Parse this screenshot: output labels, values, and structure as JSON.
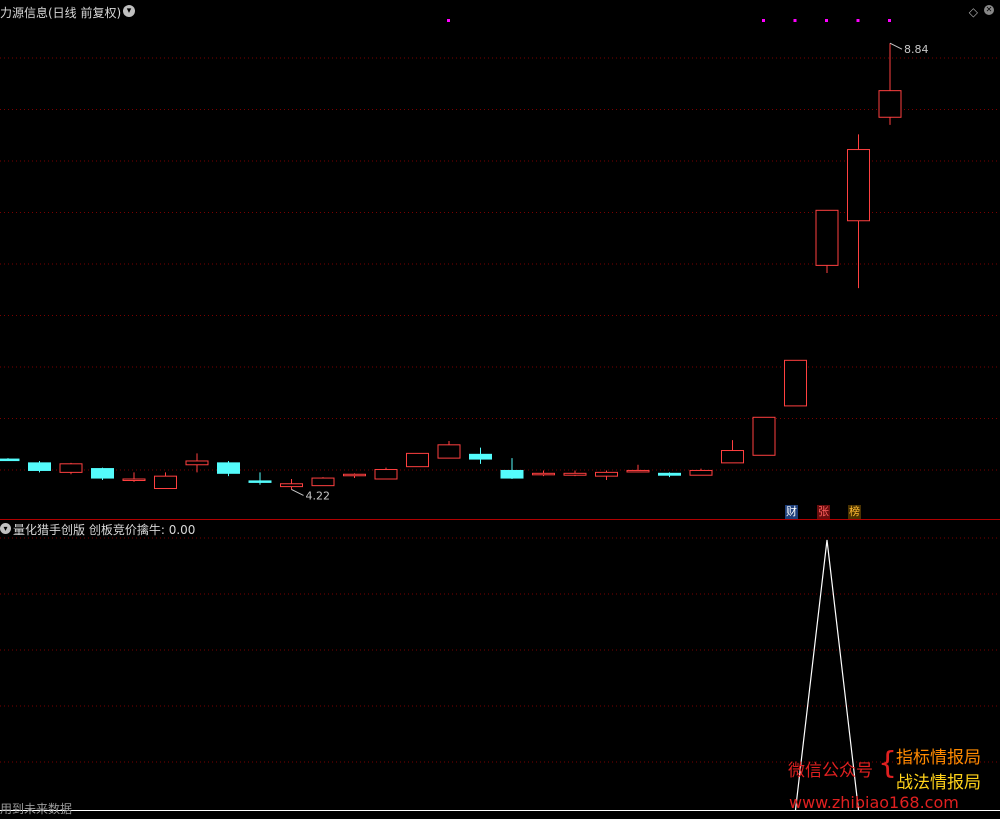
{
  "header": {
    "title": "力源信息(日线 前复权)",
    "chevron": "chevron-down-icon",
    "diamond": "◇",
    "close": "close-icon"
  },
  "indicator": {
    "label": "量化猎手创版  创板竞价擒牛: ",
    "value": "0.00"
  },
  "footer_note": "用到未来数据",
  "badges": {
    "cai": "财",
    "zhang": "张",
    "bang": "榜"
  },
  "watermark": {
    "wechat": "微信公众号",
    "line1": "指标情报局",
    "line2": "战法情报局",
    "url": "www.zhibiao168.com"
  },
  "colors": {
    "up": "#ff4040",
    "down": "#54fcfc",
    "grid": "#7a0000",
    "dot": "#ff00ff",
    "border": "#b00000"
  },
  "chart_data": {
    "type": "candlestick",
    "ylim": [
      4.05,
      9.0
    ],
    "candles": [
      {
        "o": 4.46,
        "h": 4.47,
        "l": 4.44,
        "c": 4.45
      },
      {
        "o": 4.42,
        "h": 4.44,
        "l": 4.32,
        "c": 4.34
      },
      {
        "o": 4.32,
        "h": 4.42,
        "l": 4.3,
        "c": 4.41
      },
      {
        "o": 4.36,
        "h": 4.37,
        "l": 4.24,
        "c": 4.26
      },
      {
        "o": 4.25,
        "h": 4.32,
        "l": 4.22,
        "c": 4.25
      },
      {
        "o": 4.15,
        "h": 4.32,
        "l": 4.15,
        "c": 4.28
      },
      {
        "o": 4.4,
        "h": 4.52,
        "l": 4.32,
        "c": 4.44
      },
      {
        "o": 4.42,
        "h": 4.44,
        "l": 4.28,
        "c": 4.31
      },
      {
        "o": 4.23,
        "h": 4.32,
        "l": 4.19,
        "c": 4.22
      },
      {
        "o": 4.17,
        "h": 4.25,
        "l": 4.14,
        "c": 4.2
      },
      {
        "o": 4.18,
        "h": 4.27,
        "l": 4.18,
        "c": 4.26
      },
      {
        "o": 4.29,
        "h": 4.31,
        "l": 4.26,
        "c": 4.3
      },
      {
        "o": 4.25,
        "h": 4.37,
        "l": 4.25,
        "c": 4.35
      },
      {
        "o": 4.38,
        "h": 4.52,
        "l": 4.38,
        "c": 4.52
      },
      {
        "o": 4.47,
        "h": 4.65,
        "l": 4.47,
        "c": 4.61
      },
      {
        "o": 4.51,
        "h": 4.58,
        "l": 4.41,
        "c": 4.46
      },
      {
        "o": 4.34,
        "h": 4.47,
        "l": 4.25,
        "c": 4.26
      },
      {
        "o": 4.31,
        "h": 4.34,
        "l": 4.28,
        "c": 4.31
      },
      {
        "o": 4.29,
        "h": 4.34,
        "l": 4.28,
        "c": 4.31
      },
      {
        "o": 4.28,
        "h": 4.34,
        "l": 4.24,
        "c": 4.32
      },
      {
        "o": 4.34,
        "h": 4.4,
        "l": 4.32,
        "c": 4.34
      },
      {
        "o": 4.31,
        "h": 4.32,
        "l": 4.27,
        "c": 4.29
      },
      {
        "o": 4.29,
        "h": 4.36,
        "l": 4.29,
        "c": 4.34
      },
      {
        "o": 4.42,
        "h": 4.66,
        "l": 4.42,
        "c": 4.55
      },
      {
        "o": 4.5,
        "h": 4.74,
        "l": 4.5,
        "c": 4.9
      },
      {
        "o": 5.02,
        "h": 5.5,
        "l": 5.02,
        "c": 5.5
      },
      {
        "o": 6.5,
        "h": 6.5,
        "l": 6.42,
        "c": 7.08
      },
      {
        "o": 6.97,
        "h": 7.88,
        "l": 6.26,
        "c": 7.72
      },
      {
        "o": 8.06,
        "h": 8.84,
        "l": 7.98,
        "c": 8.34
      }
    ],
    "low_label": "4.22",
    "high_label": "8.84",
    "dots": [
      14,
      24,
      25,
      26,
      27,
      28
    ],
    "indicator_series": [
      0,
      0,
      0,
      0,
      0,
      0,
      0,
      0,
      0,
      0,
      0,
      0,
      0,
      0,
      0,
      0,
      0,
      0,
      0,
      0,
      0,
      0,
      0,
      0,
      0,
      0,
      1,
      0,
      0
    ]
  }
}
